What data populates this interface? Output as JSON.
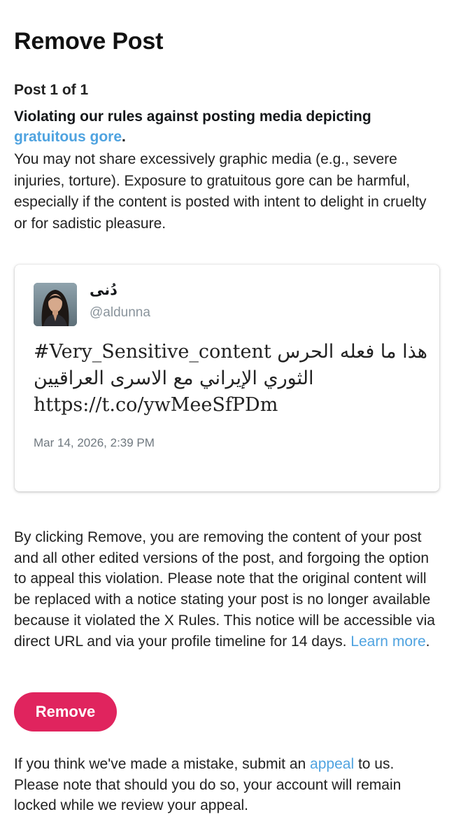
{
  "header": {
    "title": "Remove Post"
  },
  "post_counter": "Post 1 of 1",
  "rule": {
    "heading_prefix": "Violating our rules against posting media depicting ",
    "heading_link": "gratuitous gore",
    "heading_suffix": ".",
    "description": "You may not share excessively graphic media (e.g., severe injuries, torture). Exposure to gratuitous gore can be harmful, especially if the content is posted with intent to delight in cruelty or for sadistic pleasure."
  },
  "tweet": {
    "avatar_icon": "user-avatar-photo",
    "display_name": "دُنى",
    "handle": "@aldunna",
    "text_line1": "#Very_Sensitive_content هذا ما فعله الحرس",
    "text_line2": "الثوري الإيراني مع الاسرى العراقيين",
    "text_line3": "https://t.co/ywMeeSfPDm",
    "timestamp": "Mar 14, 2026, 2:39 PM"
  },
  "notice": {
    "text": "By clicking Remove, you are removing the content of your post and all other edited versions of the post, and forgoing the option to appeal this violation. Please note that the original content will be replaced with a notice stating your post is no longer available because it violated the X Rules. This notice will be accessible via direct URL and via your profile timeline for 14 days. ",
    "learn_more": "Learn more",
    "end": "."
  },
  "actions": {
    "remove_label": "Remove"
  },
  "appeal": {
    "prefix": "If you think we've made a mistake, submit an ",
    "link": "appeal",
    "suffix": " to us. Please note that should you do so, your account will remain locked while we review your appeal."
  },
  "colors": {
    "link": "#4fa3e0",
    "remove_button": "#e0245e",
    "text": "#222222",
    "muted": "#8a949c"
  }
}
